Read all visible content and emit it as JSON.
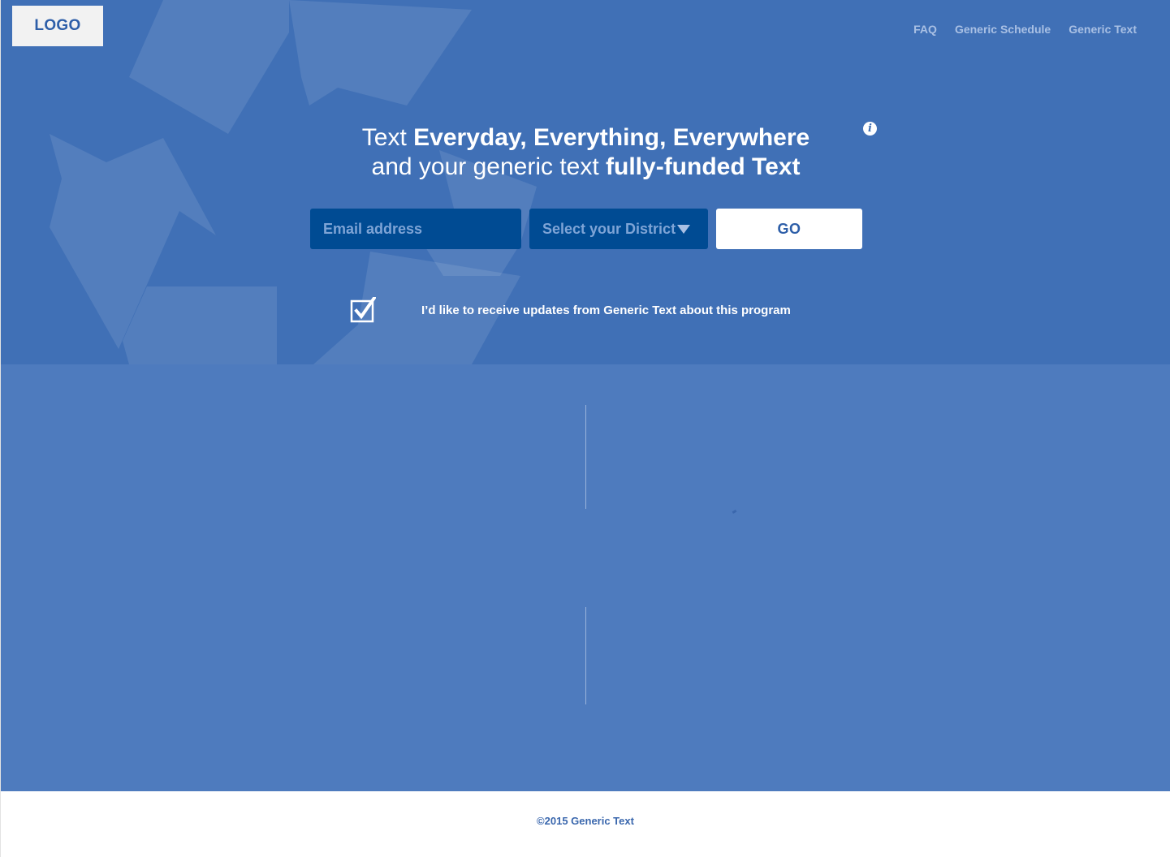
{
  "header": {
    "logo": "LOGO",
    "nav": [
      {
        "label": "FAQ"
      },
      {
        "label": "Generic Schedule"
      },
      {
        "label": "Generic Text"
      }
    ]
  },
  "hero": {
    "line1_light": "Text ",
    "line1_bold": "Everyday, Everything, Everywhere",
    "line2_light": "and your generic text ",
    "line2_bold": "fully-funded Text",
    "email_placeholder": "Email address",
    "district_placeholder": "Select your District",
    "go_label": "GO",
    "optin_checked": true,
    "optin_label": "I’d like to receive updates from Generic Text about this program"
  },
  "footer": {
    "copyright": "©2015 Generic Text"
  },
  "colors": {
    "hero_bg": "#4070b6",
    "content_bg": "#4e7bbe",
    "input_bg": "#004b93",
    "nav_text": "#a9c0e4",
    "brand_text": "#2d5ea8"
  }
}
